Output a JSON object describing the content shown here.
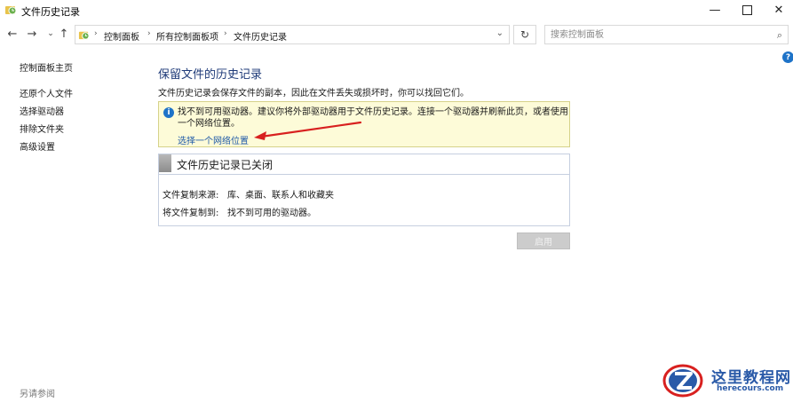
{
  "window": {
    "title": "文件历史记录",
    "minimize_glyph": "—",
    "close_glyph": "✕"
  },
  "nav": {
    "back_glyph": "←",
    "forward_glyph": "→",
    "recent_glyph": "⌄",
    "up_glyph": "↑",
    "refresh_glyph": "↻",
    "dropdown_glyph": "⌄",
    "breadcrumb": [
      "控制面板",
      "所有控制面板项",
      "文件历史记录"
    ],
    "separator": "›",
    "search_placeholder": "搜索控制面板",
    "search_glyph": "⌕",
    "help_glyph": "?"
  },
  "sidebar": {
    "home": "控制面板主页",
    "items": [
      "还原个人文件",
      "选择驱动器",
      "排除文件夹",
      "高级设置"
    ],
    "see_also": "另请参阅"
  },
  "main": {
    "title": "保留文件的历史记录",
    "description": "文件历史记录会保存文件的副本，因此在文件丢失或损坏时，你可以找回它们。",
    "warning": {
      "info_glyph": "i",
      "text": "找不到可用驱动器。建议你将外部驱动器用于文件历史记录。连接一个驱动器并刷新此页，或者使用一个网络位置。",
      "link": "选择一个网络位置"
    },
    "status": {
      "title": "文件历史记录已关闭",
      "rows": [
        {
          "label": "文件复制来源:",
          "value": "库、桌面、联系人和收藏夹"
        },
        {
          "label": "将文件复制到:",
          "value": "找不到可用的驱动器。"
        }
      ]
    },
    "enable_button": "启用"
  },
  "watermark": {
    "name": "这里教程网",
    "url": "herecours.com"
  },
  "colors": {
    "link": "#1f5aa8",
    "title_blue": "#1e3a78",
    "warning_bg": "#fdfbd8",
    "info_blue": "#1e73c8",
    "arrow_red": "#d8201f"
  }
}
